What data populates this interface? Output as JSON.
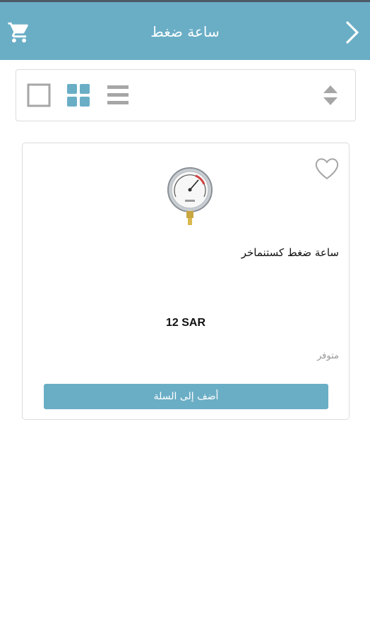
{
  "header": {
    "title": "ساعة ضغط",
    "cart_icon": "cart-icon",
    "back_icon": "chevron-right-icon",
    "bar_color": "#6aaec6"
  },
  "toolbar": {
    "view_single_icon": "square-icon",
    "view_grid_icon": "grid-icon",
    "view_list_icon": "list-icon",
    "sort_icon": "sort-icon",
    "active_color": "#6aaec6",
    "inactive_color": "#a6a6a6"
  },
  "product": {
    "name": "ساعة ضغط كستنماخر",
    "price": "12 SAR",
    "availability": "متوفر",
    "add_to_cart_label": "أضف إلى السلة",
    "favorite_icon": "heart-outline-icon",
    "image_icon": "pressure-gauge-icon"
  }
}
